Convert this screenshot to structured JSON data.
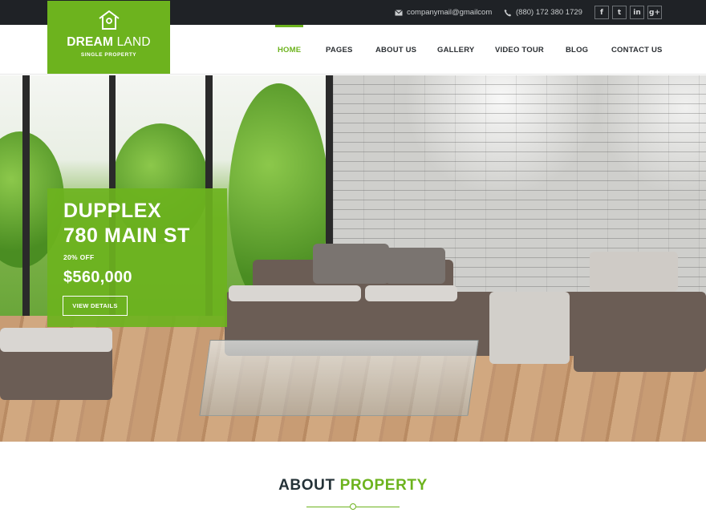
{
  "topbar": {
    "email": "companymail@gmailcom",
    "phone": "(880) 172 380 1729",
    "email_icon": "envelope-icon",
    "phone_icon": "phone-icon",
    "socials": [
      {
        "icon": "facebook-icon",
        "glyph": "f"
      },
      {
        "icon": "twitter-icon",
        "glyph": "t"
      },
      {
        "icon": "linkedin-icon",
        "glyph": "in"
      },
      {
        "icon": "google-plus-icon",
        "glyph": "g+"
      }
    ]
  },
  "logo": {
    "icon": "birdhouse-icon",
    "title_bold": "DREAM",
    "title_light": "LAND",
    "subtitle": "SINGLE PROPERTY"
  },
  "nav": {
    "items": [
      {
        "label": "HOME",
        "active": true
      },
      {
        "label": "PAGES"
      },
      {
        "label": "ABOUT US"
      },
      {
        "label": "GALLERY"
      },
      {
        "label": "VIDEO TOUR"
      },
      {
        "label": "BLOG"
      },
      {
        "label": "CONTACT US"
      }
    ]
  },
  "hero": {
    "title_line1": "DUPPLEX",
    "title_line2": "780 MAIN ST",
    "discount": "20% OFF",
    "price": "$560,000",
    "button": "VIEW DETAILS"
  },
  "about": {
    "title_part1": "ABOUT",
    "title_part2": "PROPERTY"
  },
  "colors": {
    "accent": "#6db31e",
    "topbar": "#1f2226",
    "heading_dark": "#243238"
  }
}
